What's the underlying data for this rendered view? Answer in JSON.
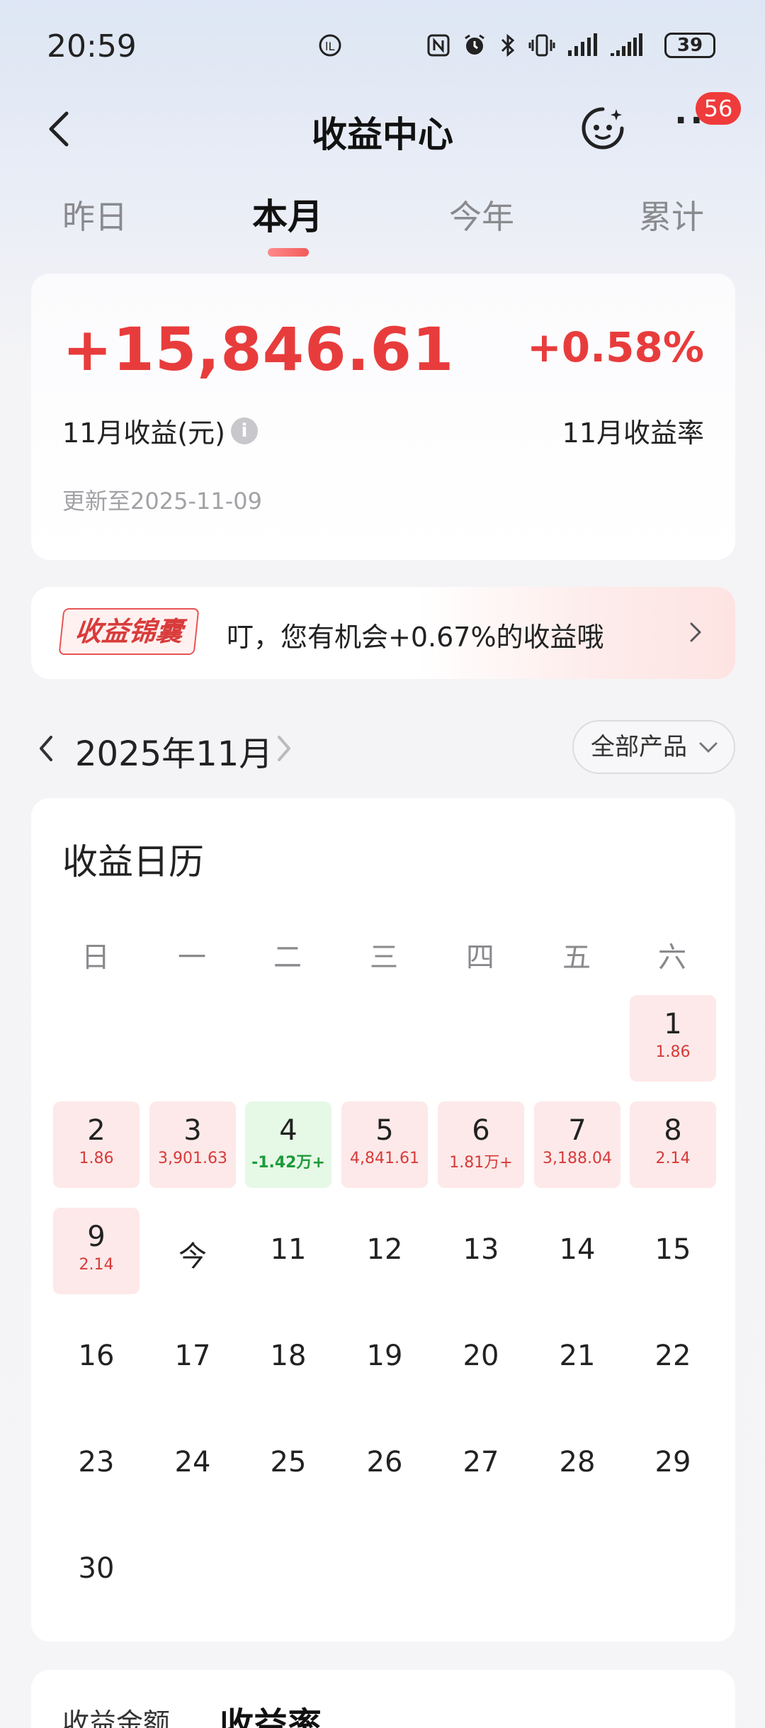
{
  "status_bar": {
    "time": "20:59",
    "battery": "39",
    "icons": [
      "nfc-icon",
      "alarm-icon",
      "bluetooth-icon",
      "vibrate-icon",
      "signal-icon",
      "signal-icon"
    ]
  },
  "nav": {
    "title": "收益中心",
    "badge": "56"
  },
  "tabs": [
    {
      "label": "昨日",
      "active": false
    },
    {
      "label": "本月",
      "active": true
    },
    {
      "label": "今年",
      "active": false
    },
    {
      "label": "累计",
      "active": false
    }
  ],
  "summary": {
    "amount": "+15,846.61",
    "amount_label": "11月收益(元)",
    "rate": "+0.58%",
    "rate_label": "11月收益率",
    "update": "更新至2025-11-09"
  },
  "tip": {
    "tag": "收益锦囊",
    "text": "叮，您有机会+0.67%的收益哦"
  },
  "month": {
    "label": "2025年11月",
    "filter": "全部产品"
  },
  "calendar": {
    "title": "收益日历",
    "weekdays": [
      "日",
      "一",
      "二",
      "三",
      "四",
      "五",
      "六"
    ],
    "days": [
      {
        "num": "1",
        "val": "1.86",
        "type": "pos"
      },
      {
        "num": "2",
        "val": "1.86",
        "type": "pos"
      },
      {
        "num": "3",
        "val": "3,901.63",
        "type": "pos"
      },
      {
        "num": "4",
        "val": "-1.42万+",
        "type": "neg"
      },
      {
        "num": "5",
        "val": "4,841.61",
        "type": "pos"
      },
      {
        "num": "6",
        "val": "1.81万+",
        "type": "pos"
      },
      {
        "num": "7",
        "val": "3,188.04",
        "type": "pos"
      },
      {
        "num": "8",
        "val": "2.14",
        "type": "pos"
      },
      {
        "num": "9",
        "val": "2.14",
        "type": "pos"
      },
      {
        "num": "今",
        "val": "",
        "type": ""
      },
      {
        "num": "11",
        "val": "",
        "type": ""
      },
      {
        "num": "12",
        "val": "",
        "type": ""
      },
      {
        "num": "13",
        "val": "",
        "type": ""
      },
      {
        "num": "14",
        "val": "",
        "type": ""
      },
      {
        "num": "15",
        "val": "",
        "type": ""
      },
      {
        "num": "16",
        "val": "",
        "type": ""
      },
      {
        "num": "17",
        "val": "",
        "type": ""
      },
      {
        "num": "18",
        "val": "",
        "type": ""
      },
      {
        "num": "19",
        "val": "",
        "type": ""
      },
      {
        "num": "20",
        "val": "",
        "type": ""
      },
      {
        "num": "21",
        "val": "",
        "type": ""
      },
      {
        "num": "22",
        "val": "",
        "type": ""
      },
      {
        "num": "23",
        "val": "",
        "type": ""
      },
      {
        "num": "24",
        "val": "",
        "type": ""
      },
      {
        "num": "25",
        "val": "",
        "type": ""
      },
      {
        "num": "26",
        "val": "",
        "type": ""
      },
      {
        "num": "27",
        "val": "",
        "type": ""
      },
      {
        "num": "28",
        "val": "",
        "type": ""
      },
      {
        "num": "29",
        "val": "",
        "type": ""
      },
      {
        "num": "30",
        "val": "",
        "type": ""
      }
    ]
  },
  "bottom": {
    "tab1": "收益金额",
    "tab2": "收益率"
  },
  "colors": {
    "accent_red": "#e83c3c",
    "positive_bg": "#fde9e9",
    "negative_bg": "#e6f8e6",
    "negative_text": "#1e9a3a"
  }
}
